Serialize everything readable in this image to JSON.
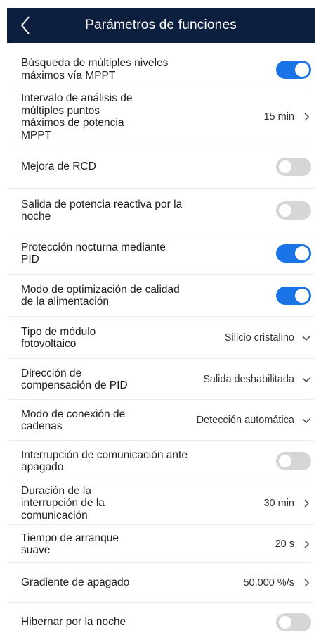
{
  "header": {
    "title": "Parámetros de funciones"
  },
  "rows": [
    {
      "label": "Búsqueda de múltiples niveles máximos vía MPPT",
      "type": "toggle",
      "on": true
    },
    {
      "label": "Intervalo de análisis de múltiples puntos máximos de potencia MPPT",
      "type": "nav",
      "value": "15 min"
    },
    {
      "label": "Mejora de RCD",
      "type": "toggle",
      "on": false
    },
    {
      "label": "Salida de potencia reactiva por la noche",
      "type": "toggle",
      "on": false
    },
    {
      "label": "Protección nocturna mediante PID",
      "type": "toggle",
      "on": true
    },
    {
      "label": "Modo de optimización de calidad de la alimentación",
      "type": "toggle",
      "on": true
    },
    {
      "label": "Tipo de módulo fotovoltaico",
      "type": "select",
      "value": "Silicio cristalino"
    },
    {
      "label": "Dirección de compensación de PID",
      "type": "select",
      "value": "Salida deshabilitada"
    },
    {
      "label": "Modo de conexión de cadenas",
      "type": "select",
      "value": "Detección automática"
    },
    {
      "label": "Interrupción de comunicación ante apagado",
      "type": "toggle",
      "on": false
    },
    {
      "label": "Duración de la interrupción de la comunicación",
      "type": "nav",
      "value": "30 min"
    },
    {
      "label": "Tiempo de arranque suave",
      "type": "nav",
      "value": "20 s"
    },
    {
      "label": "Gradiente de apagado",
      "type": "nav",
      "value": "50,000 %/s"
    },
    {
      "label": "Hibernar por la noche",
      "type": "toggle",
      "on": false
    }
  ],
  "colors": {
    "header_bg": "#0d1f3f",
    "toggle_on": "#1a74e8",
    "toggle_off": "#d6d6d6"
  },
  "icons": {
    "back": "back-chevron-icon",
    "nav": "chevron-right-icon",
    "select": "chevron-down-icon"
  }
}
